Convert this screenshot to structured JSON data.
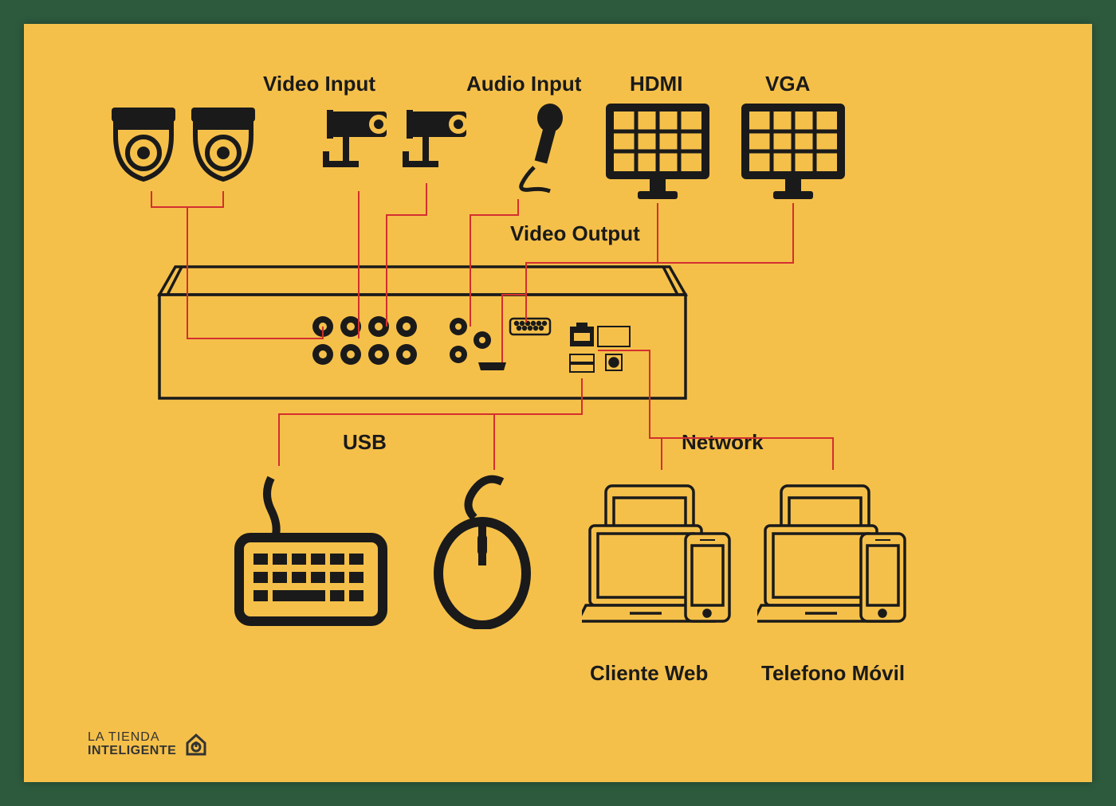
{
  "labels": {
    "video_input": "Video Input",
    "audio_input": "Audio Input",
    "hdmi": "HDMI",
    "vga": "VGA",
    "video_output": "Video Output",
    "usb": "USB",
    "network": "Network",
    "cliente_web": "Cliente Web",
    "telefono_movil": "Telefono Móvil"
  },
  "logo": {
    "line1": "LA TIENDA",
    "line2": "INTELIGENTE"
  },
  "colors": {
    "bg_outer": "#2d5a3d",
    "bg_inner": "#f5c04a",
    "wire": "#d32f2f",
    "ink": "#1a1a1a"
  }
}
